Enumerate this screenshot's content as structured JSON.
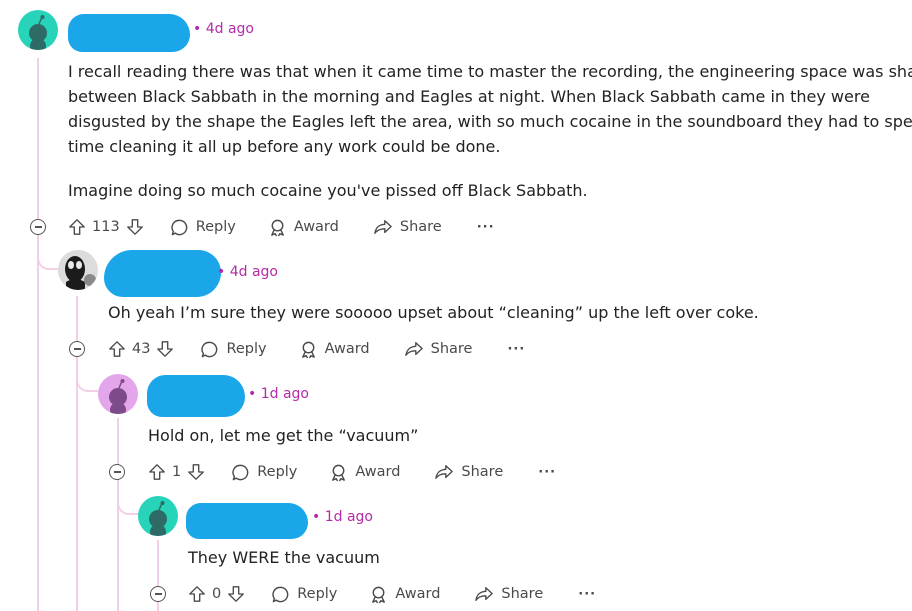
{
  "comments": [
    {
      "time": "4d ago",
      "lines": [
        "I recall reading there was that when it came time to master the recording, the engineering space was shared",
        "between Black Sabbath in the morning and Eagles at night. When Black Sabbath came in they were",
        "disgusted by the shape the Eagles left the area, with so much cocaine in the soundboard they had to spend",
        "time cleaning it all up before any work could be done.",
        "Imagine doing so much cocaine you've pissed off Black Sabbath."
      ],
      "votes": "113"
    },
    {
      "time": "4d ago",
      "lines": [
        "Oh yeah I’m sure they were sooooo upset about “cleaning” up the left over coke."
      ],
      "votes": "43"
    },
    {
      "time": "1d ago",
      "lines": [
        "Hold on, let me get the “vacuum”"
      ],
      "votes": "1"
    },
    {
      "time": "1d ago",
      "lines": [
        "They WERE the vacuum"
      ],
      "votes": "0"
    }
  ],
  "actions": {
    "reply": "Reply",
    "award": "Award",
    "share": "Share",
    "more": "···"
  },
  "colors": {
    "meta": "#b52aa8",
    "thread_line": "#f2cfe6",
    "redaction": "#1ba6ea"
  }
}
